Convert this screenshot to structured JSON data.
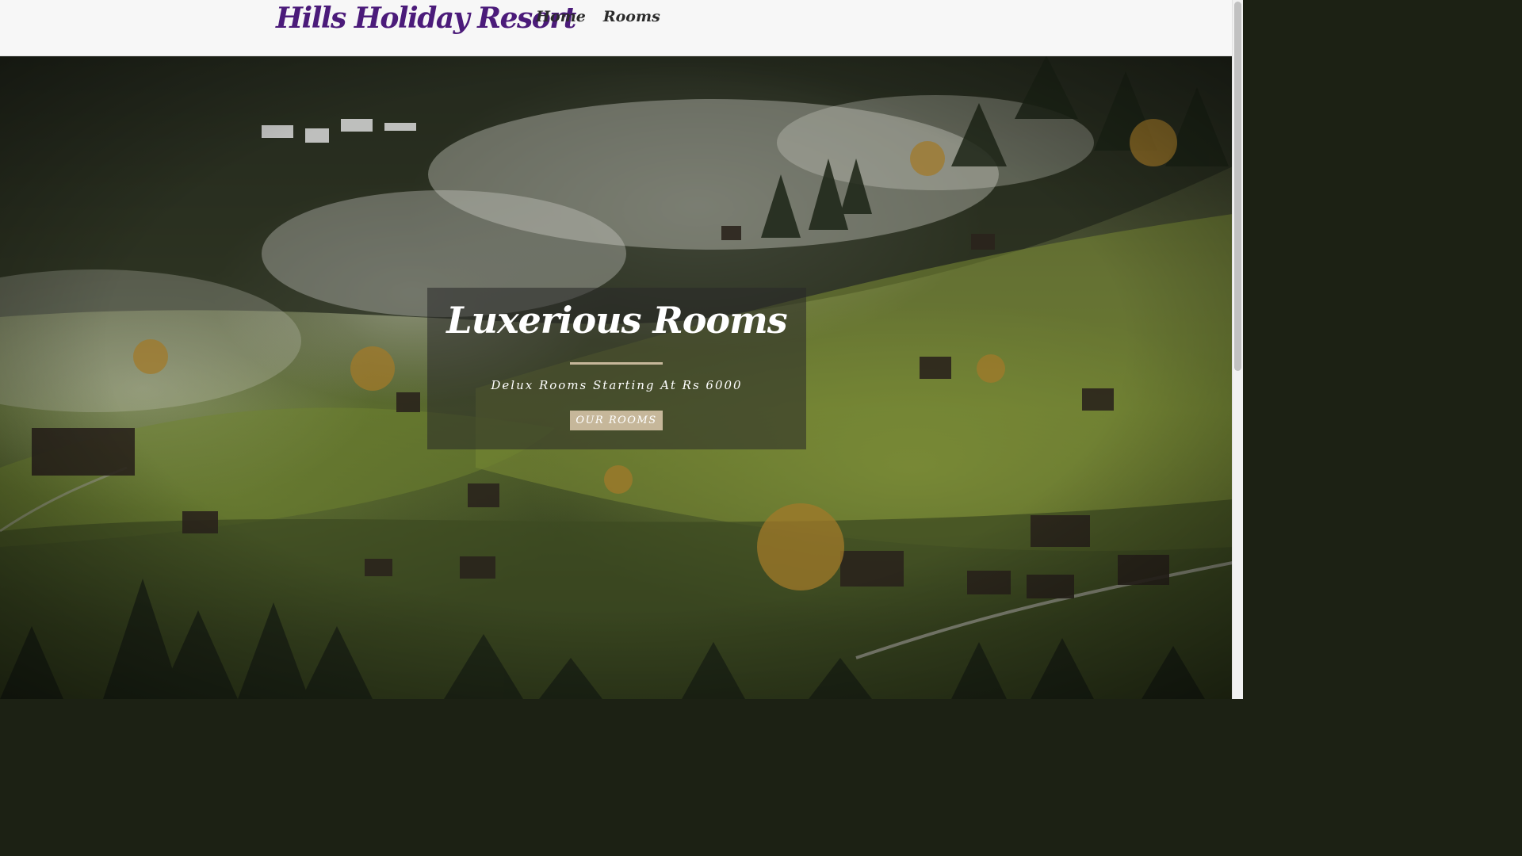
{
  "header": {
    "logo": "Hills Holiday Resort",
    "nav": [
      {
        "label": "Home"
      },
      {
        "label": "Rooms"
      }
    ]
  },
  "hero": {
    "image": "misty-hillside-village-photo",
    "title": "Luxerious Rooms",
    "subtitle": "Delux Rooms Starting At Rs 6000",
    "cta_label": "OUR ROOMS"
  },
  "colors": {
    "logo": "#4b1b7a",
    "accent": "#c6b79a",
    "header_bg": "#f7f7f7",
    "caption_bg": "rgba(40,40,40,0.55)"
  }
}
